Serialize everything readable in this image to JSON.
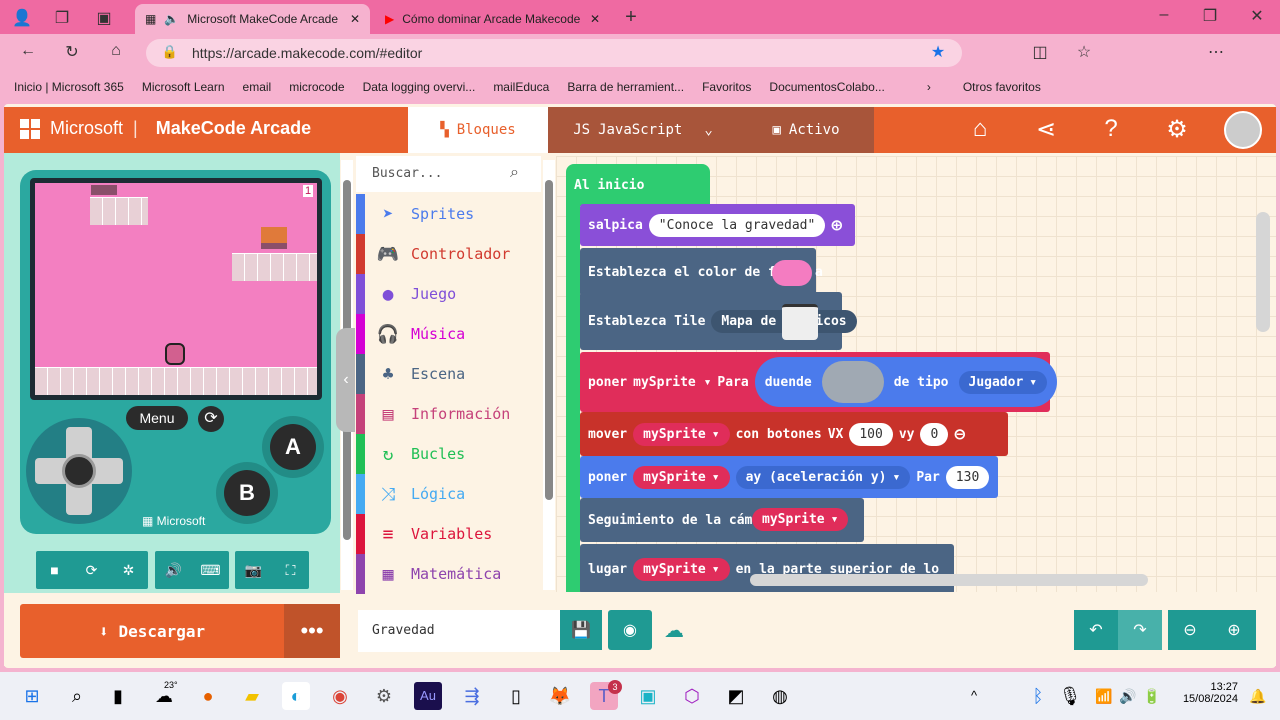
{
  "browser": {
    "tabs": [
      {
        "label": "Microsoft MakeCode Arcade"
      },
      {
        "label": "Cómo dominar Arcade Makecode"
      }
    ],
    "url": "https://arcade.makecode.com/#editor",
    "bookmarks": [
      "Inicio | Microsoft 365",
      "Microsoft Learn",
      "email",
      "microcode",
      "Data logging overvi...",
      "mailEduca",
      "Barra de herramient...",
      "Favoritos",
      "DocumentosColabo..."
    ],
    "other_favorites": "Otros favoritos"
  },
  "header": {
    "brand": "Microsoft",
    "product": "MakeCode Arcade",
    "tabs": {
      "blocks": "Bloques",
      "javascript": "JavaScript",
      "assets": "Activo"
    }
  },
  "simulator": {
    "menu": "Menu",
    "a": "A",
    "b": "B",
    "brand": "Microsoft",
    "score": "1"
  },
  "toolbox": {
    "search_placeholder": "Buscar...",
    "categories": [
      {
        "label": "Sprites",
        "color": "#4b7bec",
        "icon": "paper-plane"
      },
      {
        "label": "Controlador",
        "color": "#d13a2f",
        "icon": "gamepad"
      },
      {
        "label": "Juego",
        "color": "#7f4fd8",
        "icon": "circle"
      },
      {
        "label": "Música",
        "color": "#d400d4",
        "icon": "headphones"
      },
      {
        "label": "Escena",
        "color": "#4b6584",
        "icon": "tree"
      },
      {
        "label": "Información",
        "color": "#c5417a",
        "icon": "id-card"
      },
      {
        "label": "Bucles",
        "color": "#20bf55",
        "icon": "refresh"
      },
      {
        "label": "Lógica",
        "color": "#45aaf2",
        "icon": "shuffle"
      },
      {
        "label": "Variables",
        "color": "#dc143c",
        "icon": "list"
      },
      {
        "label": "Matemática",
        "color": "#8e44ad",
        "icon": "calculator"
      }
    ]
  },
  "blocks": {
    "on_start": "Al inicio",
    "splash": {
      "label": "salpica",
      "text": "Conoce la gravedad"
    },
    "bg_color": "Establezca el color de fondo a",
    "tilemap": {
      "label": "Establezca Tile",
      "arg": "Mapa de mosaicos"
    },
    "set_sprite": {
      "label": "poner",
      "var": "mySprite",
      "to": "Para",
      "duende": "duende",
      "kind_label": "de tipo",
      "kind": "Jugador"
    },
    "move": {
      "label": "mover",
      "var": "mySprite",
      "with": "con botones",
      "vx_label": "VX",
      "vx": "100",
      "vy_label": "vy",
      "vy": "0"
    },
    "set_ay": {
      "label": "poner",
      "var": "mySprite",
      "prop": "ay (aceleración y)",
      "to": "Par",
      "value": "130"
    },
    "camera": {
      "label": "Seguimiento de la cámara",
      "var": "mySprite"
    },
    "place": {
      "label": "lugar",
      "var": "mySprite",
      "rest": "en la parte superior de lo"
    }
  },
  "bottom": {
    "download": "Descargar",
    "project_name": "Gravedad"
  },
  "taskbar": {
    "weather": "23°",
    "time": "13:27",
    "date": "15/08/2024",
    "teams_badge": "3"
  }
}
